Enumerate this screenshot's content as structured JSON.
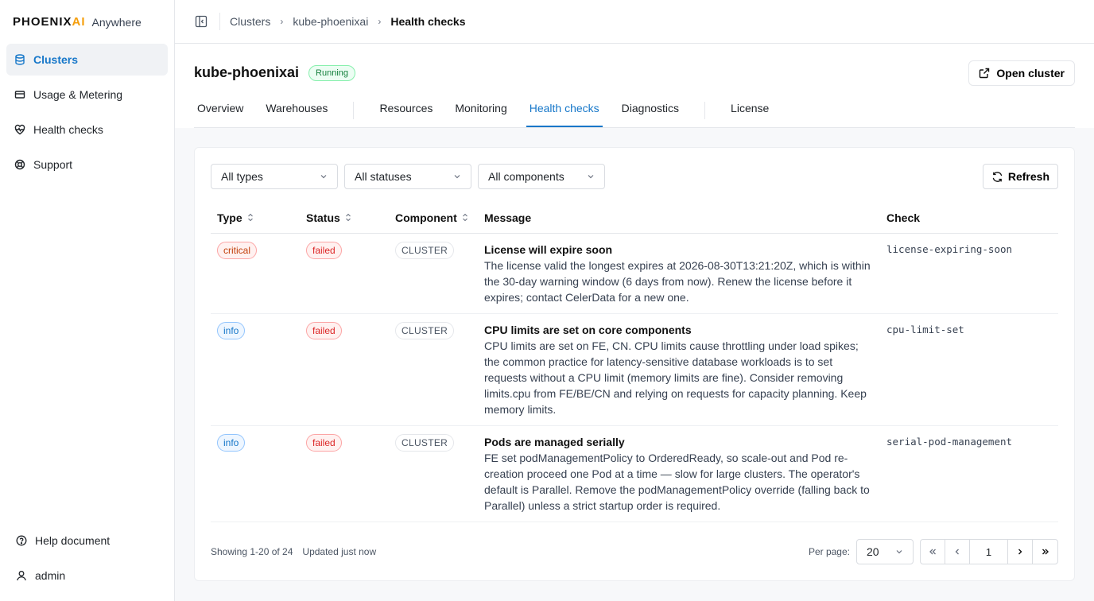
{
  "brand": {
    "logo_main": "PHOENIX",
    "logo_ai": "AI",
    "subtitle": "Anywhere"
  },
  "sidebar": {
    "items": [
      {
        "label": "Clusters",
        "icon": "database-icon",
        "active": true
      },
      {
        "label": "Usage & Metering",
        "icon": "credit-card-icon"
      },
      {
        "label": "Health checks",
        "icon": "heart-pulse-icon"
      },
      {
        "label": "Support",
        "icon": "lifebuoy-icon"
      }
    ],
    "bottom": [
      {
        "label": "Help document",
        "icon": "help-circle-icon"
      },
      {
        "label": "admin",
        "icon": "user-icon"
      }
    ]
  },
  "breadcrumb": {
    "items": [
      "Clusters",
      "kube-phoenixai",
      "Health checks"
    ]
  },
  "header": {
    "cluster_name": "kube-phoenixai",
    "status": "Running",
    "open_cluster_label": "Open cluster",
    "tabs": [
      "Overview",
      "Warehouses",
      "Resources",
      "Monitoring",
      "Health checks",
      "Diagnostics",
      "License"
    ],
    "active_tab": "Health checks"
  },
  "filters": {
    "type": "All types",
    "status": "All statuses",
    "component": "All components",
    "refresh_label": "Refresh"
  },
  "table": {
    "columns": {
      "type": "Type",
      "status": "Status",
      "component": "Component",
      "message": "Message",
      "check": "Check"
    },
    "rows": [
      {
        "type": "critical",
        "status": "failed",
        "component": "CLUSTER",
        "title": "License will expire soon",
        "body": "The license valid the longest expires at 2026-08-30T13:21:20Z, which is within the 30-day warning window (6 days from now). Renew the license before it expires; contact CelerData for a new one.",
        "check": "license-expiring-soon"
      },
      {
        "type": "info",
        "status": "failed",
        "component": "CLUSTER",
        "title": "CPU limits are set on core components",
        "body": "CPU limits are set on FE, CN. CPU limits cause throttling under load spikes; the common practice for latency-sensitive database workloads is to set requests without a CPU limit (memory limits are fine). Consider removing limits.cpu from FE/BE/CN and relying on requests for capacity planning. Keep memory limits.",
        "check": "cpu-limit-set"
      },
      {
        "type": "info",
        "status": "failed",
        "component": "CLUSTER",
        "title": "Pods are managed serially",
        "body": "FE set podManagementPolicy to OrderedReady, so scale-out and Pod re-creation proceed one Pod at a time — slow for large clusters. The operator's default is Parallel. Remove the podManagementPolicy override (falling back to Parallel) unless a strict startup order is required.",
        "check": "serial-pod-management"
      }
    ]
  },
  "footer": {
    "showing": "Showing 1-20 of 24",
    "updated": "Updated just now",
    "per_page_label": "Per page:",
    "per_page_value": "20",
    "current_page": "1"
  },
  "colors": {
    "accent": "#1677c9",
    "danger": "#dc2626",
    "success": "#15803d",
    "brand_ai": "#f59e0b"
  }
}
